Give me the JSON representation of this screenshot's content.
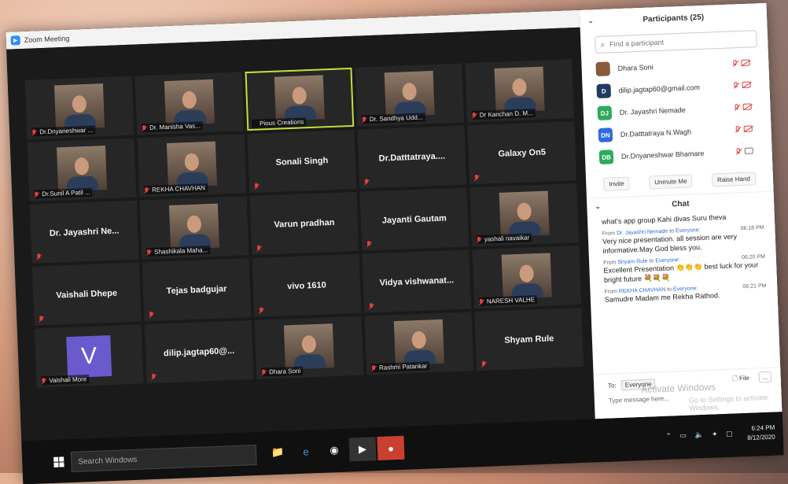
{
  "window": {
    "title": "Zoom Meeting"
  },
  "tiles": [
    {
      "name": "Dr.Dnyaneshwar ...",
      "video": true,
      "muted": true
    },
    {
      "name": "Dr. Manisha Vas...",
      "video": true,
      "muted": true
    },
    {
      "name": "Pious Creations",
      "video": true,
      "muted": false,
      "active": true
    },
    {
      "name": "Dr. Sandhya Udd...",
      "video": true,
      "muted": true
    },
    {
      "name": "Dr Kanchan D. M...",
      "video": true,
      "muted": true
    },
    {
      "name": "Dr.Sunil A Patil ...",
      "video": true,
      "muted": true
    },
    {
      "name": "REKHA CHAVHAN",
      "video": true,
      "muted": true
    },
    {
      "name": "Sonali Singh",
      "video": false,
      "muted": true
    },
    {
      "name": "Dr.Datttatraya....",
      "video": false,
      "muted": true
    },
    {
      "name": "Galaxy On5",
      "video": false,
      "muted": true
    },
    {
      "name": "Dr. Jayashri Ne...",
      "video": false,
      "muted": true
    },
    {
      "name": "Shashikala Maha...",
      "video": true,
      "muted": true
    },
    {
      "name": "Varun pradhan",
      "video": false,
      "muted": true
    },
    {
      "name": "Jayanti Gautam",
      "video": false,
      "muted": true
    },
    {
      "name": "yashali navaikar",
      "video": true,
      "muted": true
    },
    {
      "name": "Vaishali Dhepe",
      "video": false,
      "muted": true
    },
    {
      "name": "Tejas badgujar",
      "video": false,
      "muted": true
    },
    {
      "name": "vivo 1610",
      "video": false,
      "muted": true
    },
    {
      "name": "Vidya  vishwanat...",
      "video": false,
      "muted": true
    },
    {
      "name": "NARESH VALHE",
      "video": true,
      "muted": true
    },
    {
      "name": "Vaishali More",
      "video": false,
      "avatar": "V",
      "muted": true
    },
    {
      "name": "dilip.jagtap60@...",
      "video": false,
      "muted": true
    },
    {
      "name": "Dhara Soni",
      "video": true,
      "muted": true
    },
    {
      "name": "Rashmi Patankar",
      "video": true,
      "muted": true
    },
    {
      "name": "Shyam Rule",
      "video": false,
      "muted": true
    }
  ],
  "participants": {
    "title": "Participants (25)",
    "search_placeholder": "Find a participant",
    "list": [
      {
        "name": "Dhara Soni",
        "initials": "",
        "color": "#8b5a3c",
        "cam": "off"
      },
      {
        "name": "dilip.jagtap60@gmail.com",
        "initials": "D",
        "color": "#1f3b63",
        "cam": "off"
      },
      {
        "name": "Dr. Jayashri Nemade",
        "initials": "DJ",
        "color": "#2eaa5c",
        "cam": "off"
      },
      {
        "name": "Dr.Datttatraya N.Wagh",
        "initials": "DN",
        "color": "#2d6cdf",
        "cam": "off"
      },
      {
        "name": "Dr.Dnyaneshwar Bhamare",
        "initials": "DB",
        "color": "#2eaa5c",
        "cam": "on"
      }
    ],
    "actions": {
      "invite": "Invite",
      "unmute": "Unmute Me",
      "raise": "Raise Hand"
    }
  },
  "chat": {
    "title": "Chat",
    "messages": [
      {
        "from": "",
        "to": "",
        "time": "",
        "text": "what's app group Kahi divas Suru theva"
      },
      {
        "from": "Dr. Jayashri Nemade",
        "to": "Everyone",
        "time": "06:18 PM",
        "text": "Very nice presentation. all session are very informative.May God bless you."
      },
      {
        "from": "Shyam Rule",
        "to": "Everyone",
        "time": "06:20 PM",
        "text": "Excellent Presentation 👏👏👏 best luck for your bright future 💐💐💐"
      },
      {
        "from": "REKHA CHAVHAN",
        "to": "Everyone",
        "time": "06:21 PM",
        "text": "Samudre Madam me Rekha Rathod."
      }
    ],
    "to_label": "To:",
    "to_value": "Everyone",
    "file_label": "File",
    "more_label": "...",
    "input_placeholder": "Type message here...",
    "watermark_title": "Activate Windows",
    "watermark_sub": "Go to Settings to activate Windows."
  },
  "taskbar": {
    "search_placeholder": "Search Windows",
    "time": "6:24 PM",
    "date": "8/12/2020"
  },
  "labels": {
    "from": "From",
    "to_word": "to"
  },
  "window_controls": "− ❐ ✕"
}
